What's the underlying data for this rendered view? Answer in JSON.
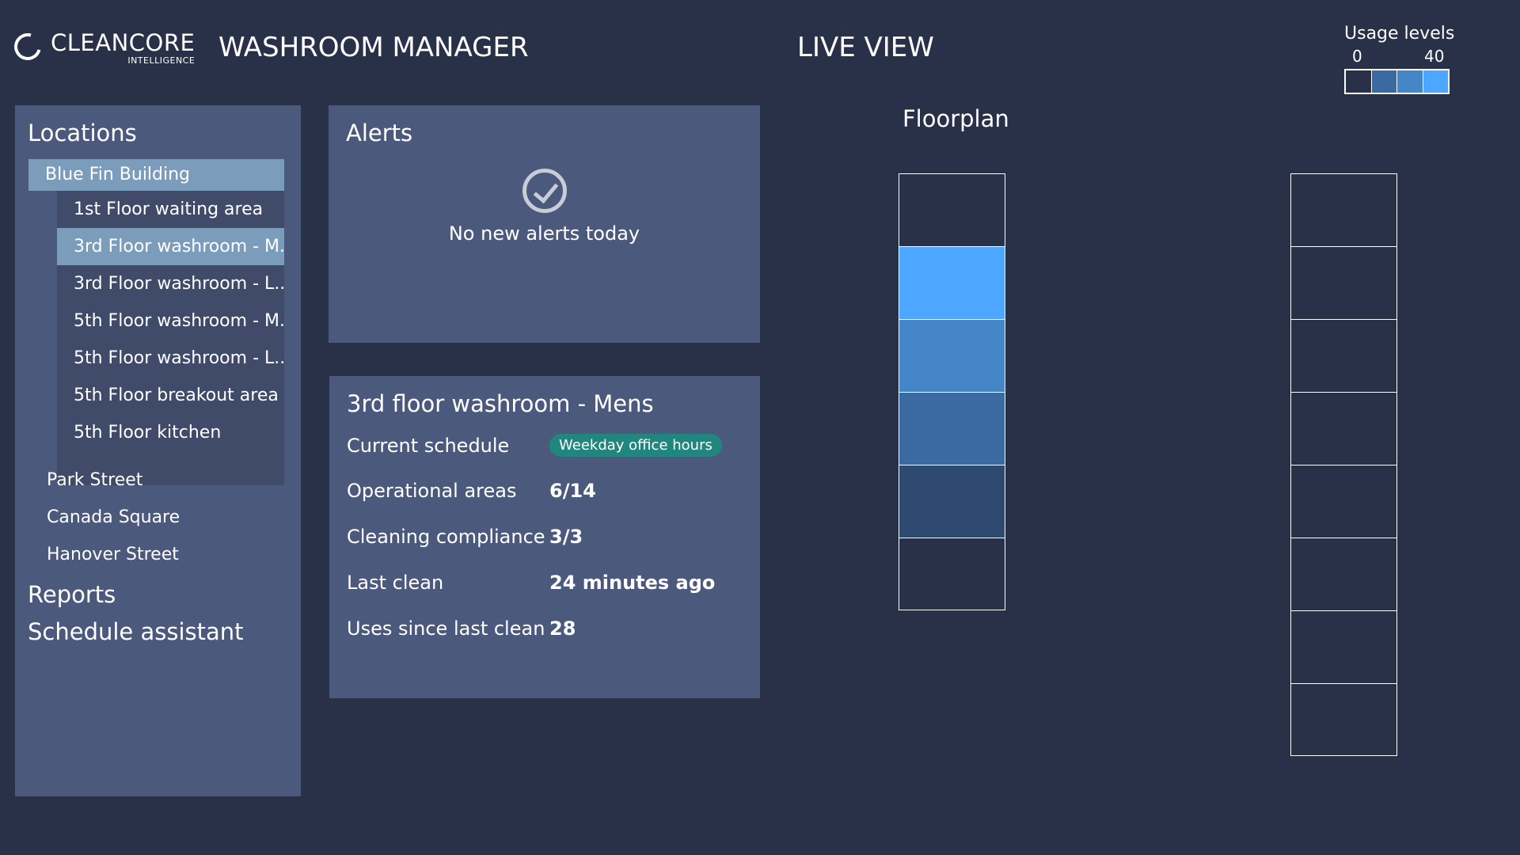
{
  "brand": {
    "name": "CLEANCORE",
    "tagline": "INTELLIGENCE"
  },
  "header": {
    "app_title": "WASHROOM MANAGER",
    "live_title": "LIVE VIEW"
  },
  "legend": {
    "title": "Usage levels",
    "min_label": "0",
    "max_label": "40",
    "colors": [
      "#293149",
      "#3b6aa3",
      "#4586c9",
      "#4da6ff"
    ]
  },
  "sidebar": {
    "heading": "Locations",
    "building": "Blue Fin Building",
    "sub_items": [
      {
        "label": "1st Floor waiting area",
        "active": false
      },
      {
        "label": "3rd Floor washroom - M...",
        "active": true
      },
      {
        "label": "3rd Floor washroom - L...",
        "active": false
      },
      {
        "label": "5th Floor washroom - M...",
        "active": false
      },
      {
        "label": "5th Floor washroom - L...",
        "active": false
      },
      {
        "label": "5th Floor breakout area",
        "active": false
      },
      {
        "label": "5th Floor kitchen",
        "active": false
      }
    ],
    "other_locations": [
      "Park Street",
      "Canada Square",
      "Hanover Street"
    ],
    "reports_label": "Reports",
    "schedule_label": "Schedule assistant"
  },
  "alerts": {
    "title": "Alerts",
    "message": "No new alerts today",
    "icon": "check-circle-icon"
  },
  "details": {
    "title": "3rd floor washroom - Mens",
    "rows": [
      {
        "label": "Current schedule",
        "value": "Weekday office hours",
        "type": "badge"
      },
      {
        "label": "Operational areas",
        "value": "6/14",
        "type": "text"
      },
      {
        "label": "Cleaning compliance",
        "value": "3/3",
        "type": "text"
      },
      {
        "label": "Last clean",
        "value": "24 minutes ago",
        "type": "text"
      },
      {
        "label": "Uses since last clean",
        "value": "28",
        "type": "text"
      }
    ]
  },
  "floorplan": {
    "title": "Floorplan",
    "left_column_colors": [
      "#293149",
      "#4da6ff",
      "#4586c9",
      "#3b6aa3",
      "#2f4a71",
      "#293149"
    ],
    "right_column_colors": [
      "#293149",
      "#293149",
      "#293149",
      "#293149",
      "#293149",
      "#293149",
      "#293149",
      "#293149"
    ]
  }
}
